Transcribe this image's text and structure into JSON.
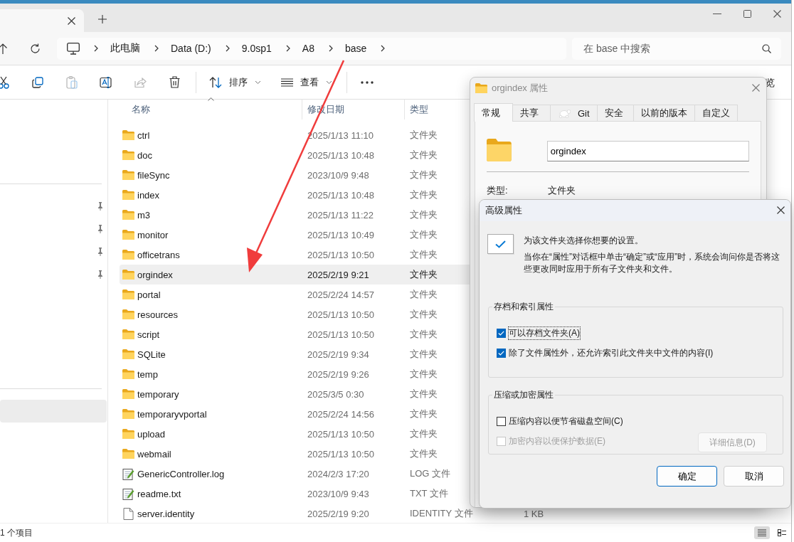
{
  "address": {
    "breadcrumbs": [
      "此电脑",
      "Data (D:)",
      "9.0sp1",
      "A8",
      "base"
    ]
  },
  "search": {
    "placeholder": "在 base 中搜索"
  },
  "toolbar": {
    "buttons": [
      {
        "kind": "cut",
        "disabled": false
      },
      {
        "kind": "copy",
        "disabled": false
      },
      {
        "kind": "paste",
        "disabled": true
      },
      {
        "kind": "rename",
        "disabled": false
      },
      {
        "kind": "share",
        "disabled": true
      },
      {
        "kind": "delete",
        "disabled": false
      },
      {
        "kind": "sort",
        "label": "排序",
        "disabled": false
      },
      {
        "kind": "view",
        "label": "查看",
        "disabled": false
      },
      {
        "kind": "more",
        "disabled": false
      }
    ],
    "partial_text": "览"
  },
  "sidebar": {
    "groups": [
      [
        {
          "pinned": true,
          "selected": false
        },
        {
          "pinned": true,
          "selected": false
        },
        {
          "pinned": true,
          "selected": false
        },
        {
          "pinned": true,
          "selected": false
        }
      ],
      [
        {
          "pinned": false,
          "selected": true
        }
      ]
    ]
  },
  "file_list": {
    "columns": [
      {
        "label": "名称",
        "sorted": true
      },
      {
        "label": "修改日期",
        "sorted": false
      },
      {
        "label": "类型",
        "sorted": false
      }
    ],
    "rows": [
      {
        "kind": "folder",
        "name": "ctrl",
        "modified": "2025/1/13 11:10",
        "type": "文件夹",
        "selected": false
      },
      {
        "kind": "folder",
        "name": "doc",
        "modified": "2025/1/13 10:48",
        "type": "文件夹",
        "selected": false
      },
      {
        "kind": "folder",
        "name": "fileSync",
        "modified": "2023/10/9 9:48",
        "type": "文件夹",
        "selected": false
      },
      {
        "kind": "folder",
        "name": "index",
        "modified": "2025/1/13 10:48",
        "type": "文件夹",
        "selected": false
      },
      {
        "kind": "folder",
        "name": "m3",
        "modified": "2025/1/13 11:22",
        "type": "文件夹",
        "selected": false
      },
      {
        "kind": "folder",
        "name": "monitor",
        "modified": "2025/1/13 10:49",
        "type": "文件夹",
        "selected": false
      },
      {
        "kind": "folder",
        "name": "officetrans",
        "modified": "2025/1/13 10:50",
        "type": "文件夹",
        "selected": false
      },
      {
        "kind": "folder",
        "name": "orgindex",
        "modified": "2025/2/19 9:21",
        "type": "文件夹",
        "selected": true
      },
      {
        "kind": "folder",
        "name": "portal",
        "modified": "2025/2/24 14:57",
        "type": "文件夹",
        "selected": false
      },
      {
        "kind": "folder",
        "name": "resources",
        "modified": "2025/1/13 10:50",
        "type": "文件夹",
        "selected": false
      },
      {
        "kind": "folder",
        "name": "script",
        "modified": "2025/1/13 10:50",
        "type": "文件夹",
        "selected": false
      },
      {
        "kind": "folder",
        "name": "SQLite",
        "modified": "2025/2/19 9:34",
        "type": "文件夹",
        "selected": false
      },
      {
        "kind": "folder",
        "name": "temp",
        "modified": "2025/2/19 9:26",
        "type": "文件夹",
        "selected": false
      },
      {
        "kind": "folder",
        "name": "temporary",
        "modified": "2025/3/5 0:30",
        "type": "文件夹",
        "selected": false
      },
      {
        "kind": "folder",
        "name": "temporaryvportal",
        "modified": "2025/2/24 14:56",
        "type": "文件夹",
        "selected": false
      },
      {
        "kind": "folder",
        "name": "upload",
        "modified": "2025/1/13 10:50",
        "type": "文件夹",
        "selected": false
      },
      {
        "kind": "folder",
        "name": "webmail",
        "modified": "2025/1/13 10:50",
        "type": "文件夹",
        "selected": false
      },
      {
        "kind": "text",
        "name": "GenericController.log",
        "modified": "2024/2/3 17:20",
        "type": "LOG 文件",
        "selected": false
      },
      {
        "kind": "text",
        "name": "readme.txt",
        "modified": "2023/10/9 9:43",
        "type": "TXT 文件",
        "selected": false
      },
      {
        "kind": "file",
        "name": "server.identity",
        "modified": "2025/2/19 9:20",
        "type": "IDENTITY 文件",
        "size": "1 KB",
        "selected": false
      }
    ]
  },
  "status_bar": {
    "item_count": "1 个项目",
    "views": [
      {
        "kind": "details",
        "selected": true
      },
      {
        "kind": "tiles",
        "selected": false
      }
    ]
  },
  "properties_dialog": {
    "title": "orgindex 属性",
    "tabs": [
      {
        "label": "常规",
        "selected": true
      },
      {
        "label": "共享",
        "selected": false
      },
      {
        "label": "Git",
        "kind": "git",
        "selected": false
      },
      {
        "label": "安全",
        "selected": false
      },
      {
        "label": "以前的版本",
        "selected": false
      },
      {
        "label": "自定义",
        "selected": false
      }
    ],
    "name": "orgindex",
    "fields": [
      {
        "label": "类型:",
        "value": "文件夹"
      }
    ]
  },
  "advanced_dialog": {
    "title": "高级属性",
    "intro": "为该文件夹选择你想要的设置。",
    "description": "当你在“属性”对话框中单击“确定”或“应用”时，系统会询问你是否将这些更改同时应用于所有子文件夹和文件。",
    "groups": [
      {
        "title": "存档和索引属性",
        "options": [
          {
            "label": "可以存档文件夹(A)",
            "checked": true,
            "disabled": false,
            "focused": true
          },
          {
            "label": "除了文件属性外，还允许索引此文件夹中文件的内容(I)",
            "checked": true,
            "disabled": false,
            "focused": false
          }
        ]
      },
      {
        "title": "压缩或加密属性",
        "options": [
          {
            "label": "压缩内容以便节省磁盘空间(C)",
            "checked": false,
            "disabled": false,
            "focused": false
          },
          {
            "label": "加密内容以便保护数据(E)",
            "checked": false,
            "disabled": true,
            "focused": false
          }
        ],
        "button": {
          "label": "详细信息(D)",
          "disabled": true
        }
      }
    ],
    "buttons": [
      {
        "label": "确定",
        "default": true
      },
      {
        "label": "取消",
        "default": false
      }
    ]
  }
}
